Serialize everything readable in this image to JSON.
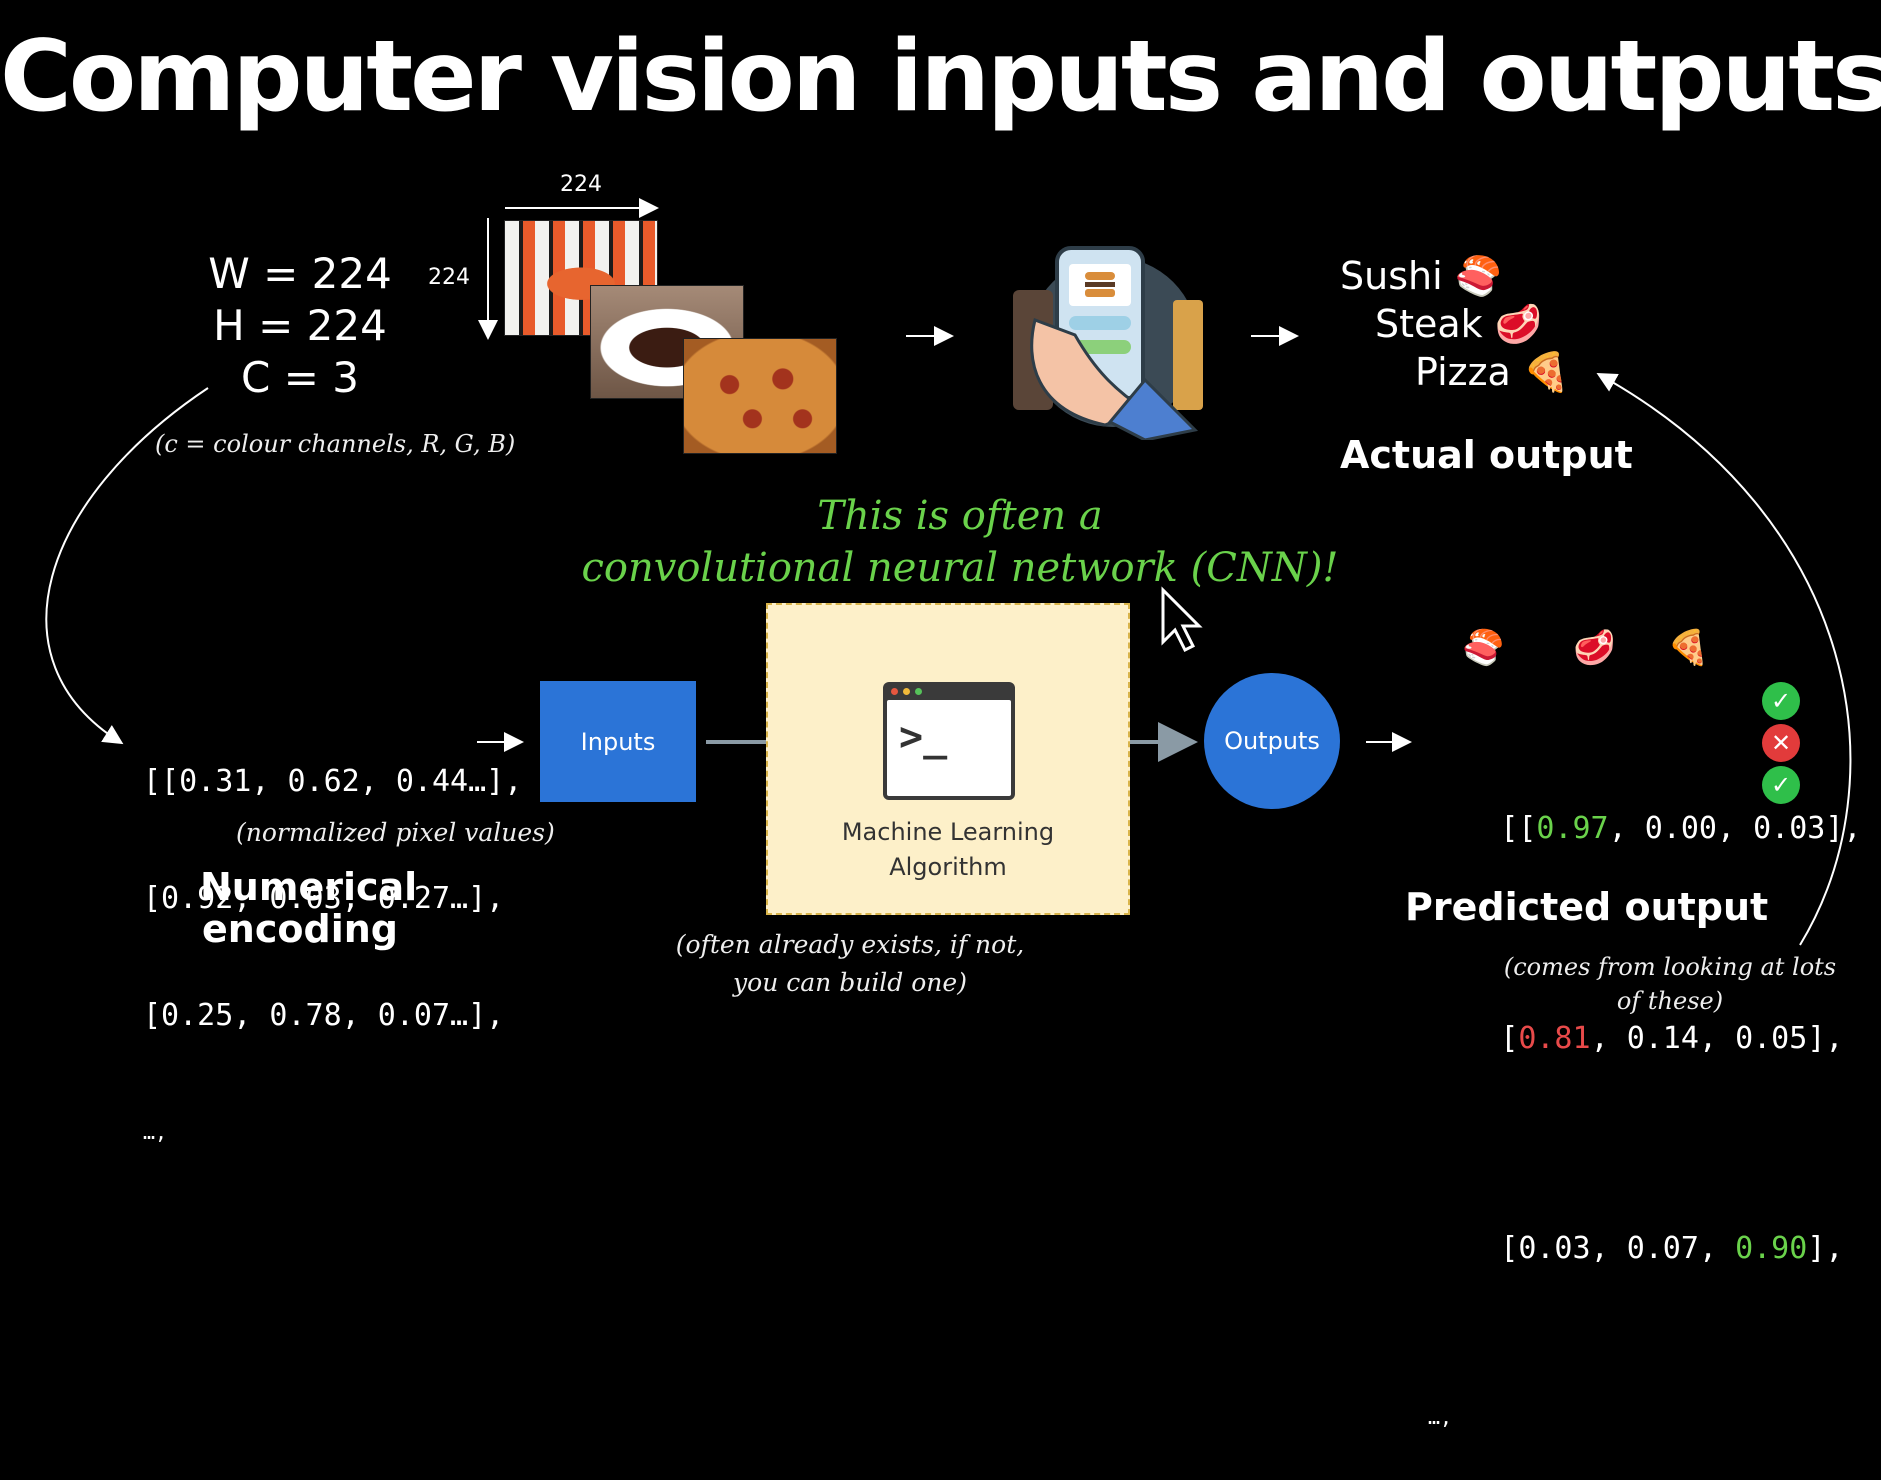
{
  "title": "Computer vision inputs and outputs",
  "dimensions": {
    "width": "W = 224",
    "height": "H = 224",
    "channels": "C = 3",
    "note": "(c = colour channels, R, G, B)"
  },
  "image_size": {
    "top": "224",
    "side": "224"
  },
  "actual_output": {
    "items": [
      {
        "label": "Sushi",
        "emoji": "🍣"
      },
      {
        "label": "Steak",
        "emoji": "🥩"
      },
      {
        "label": "Pizza",
        "emoji": "🍕"
      }
    ],
    "heading": "Actual output"
  },
  "cnn_note": {
    "line1": "This is often a",
    "line2": "convolutional neural network (CNN)!"
  },
  "numerical_encoding": {
    "rows": [
      "[[0.31, 0.62, 0.44…],",
      "[0.92, 0.03, 0.27…],",
      "[0.25, 0.78, 0.07…],",
      "…,"
    ],
    "note": "(normalized pixel values)",
    "heading_line1": "Numerical",
    "heading_line2": "encoding"
  },
  "inputs_label": "Inputs",
  "algorithm": {
    "line1": "Machine Learning",
    "line2": "Algorithm",
    "prompt": ">_",
    "note_line1": "(often already exists, if not,",
    "note_line2": "you can build one)"
  },
  "outputs_label": "Outputs",
  "predicted_output": {
    "header_emojis": [
      "🍣",
      "🥩",
      "🍕"
    ],
    "rows": [
      {
        "open": "[[",
        "v1": "0.97",
        "sep1": ", ",
        "v2": "0.00",
        "sep2": ", ",
        "v3": "0.03",
        "close": "],",
        "result": "✓"
      },
      {
        "open": "[",
        "v1": "0.81",
        "sep1": ", ",
        "v2": "0.14",
        "sep2": ", ",
        "v3": "0.05",
        "close": "],",
        "result": "✕"
      },
      {
        "open": "[",
        "v1": "0.03",
        "sep1": ", ",
        "v2": "0.07",
        "sep2": ", ",
        "v3": "0.90",
        "close": "],",
        "result": "✓"
      }
    ],
    "ellipsis": "…,",
    "heading": "Predicted output",
    "note_line1": "(comes from looking at lots",
    "note_line2": "of these)"
  },
  "colors": {
    "background": "#000000",
    "blue": "#2b74d7",
    "green_text": "#6ad24b",
    "red_text": "#e84a4a",
    "algo_box": "#fdf0c9"
  }
}
